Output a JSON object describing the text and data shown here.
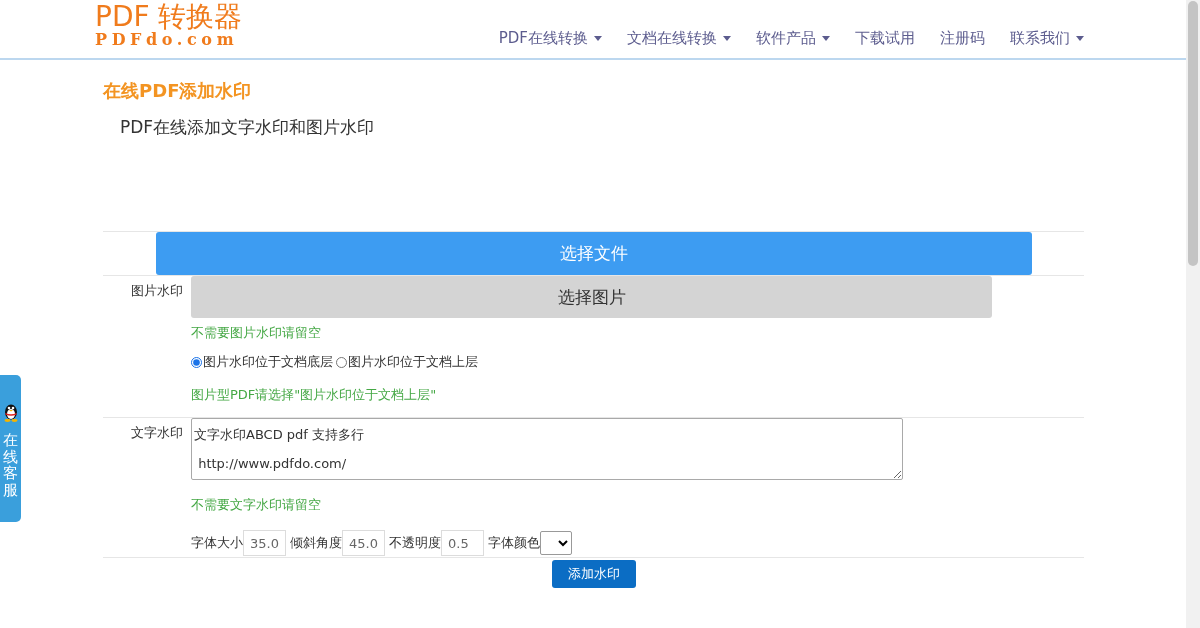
{
  "header": {
    "logo": {
      "title": "PDF 转换器",
      "domain": "PDFdo.com"
    },
    "nav": [
      {
        "label": "PDF在线转换",
        "dropdown": true
      },
      {
        "label": "文档在线转换",
        "dropdown": true
      },
      {
        "label": "软件产品",
        "dropdown": true
      },
      {
        "label": "下载试用",
        "dropdown": false
      },
      {
        "label": "注册码",
        "dropdown": false
      },
      {
        "label": "联系我们",
        "dropdown": true
      }
    ]
  },
  "page": {
    "title": "在线PDF添加水印",
    "subtitle": "PDF在线添加文字水印和图片水印"
  },
  "form": {
    "file_button": "选择文件",
    "image_watermark": {
      "label": "图片水印",
      "button": "选择图片",
      "hint": "不需要图片水印请留空",
      "positions": [
        {
          "label": "图片水印位于文档底层",
          "selected": true
        },
        {
          "label": "图片水印位于文档上层",
          "selected": false
        }
      ],
      "note": "图片型PDF请选择\"图片水印位于文档上层\""
    },
    "text_watermark": {
      "label": "文字水印",
      "value": "文字水印ABCD pdf 支持多行\n http://www.pdfdo.com/",
      "hint": "不需要文字水印请留空",
      "settings": [
        {
          "kind": "input",
          "label": "字体大小",
          "value": "35.0"
        },
        {
          "kind": "input",
          "label": "倾斜角度",
          "value": "45.0"
        },
        {
          "kind": "input",
          "label": "不透明度",
          "value": "0.5"
        },
        {
          "kind": "select",
          "label": "字体颜色"
        }
      ]
    },
    "submit_button": "添加水印"
  },
  "chat_tab": {
    "label": "在线客服"
  }
}
